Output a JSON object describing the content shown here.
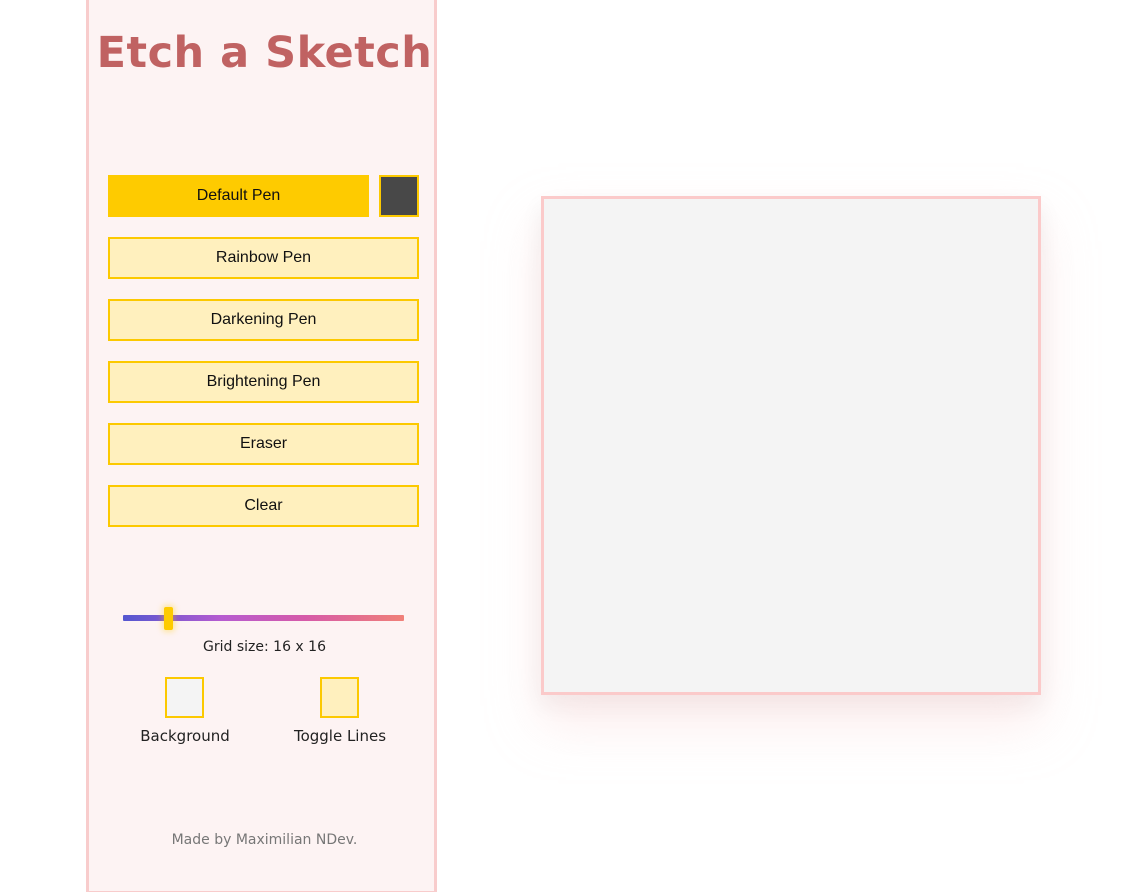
{
  "app": {
    "title": "Etch a Sketch",
    "credit": "Made by Maximilian NDev."
  },
  "pens": {
    "default": "Default Pen",
    "rainbow": "Rainbow Pen",
    "darkening": "Darkening Pen",
    "brightening": "Brightening Pen",
    "eraser": "Eraser",
    "clear": "Clear",
    "active": "Default Pen",
    "pen_color": "#484848"
  },
  "grid": {
    "label": "Grid size: 16 x 16",
    "size": 16
  },
  "toggles": {
    "background_label": "Background",
    "background_color": "#f4f4f4",
    "lines_label": "Toggle Lines",
    "lines_color": "#fff0be"
  },
  "colors": {
    "accent": "#fecb00",
    "title": "#c06262",
    "sidebar_bg": "#fdf3f3",
    "border": "#f8cccc",
    "canvas_bg": "#f4f4f4"
  }
}
